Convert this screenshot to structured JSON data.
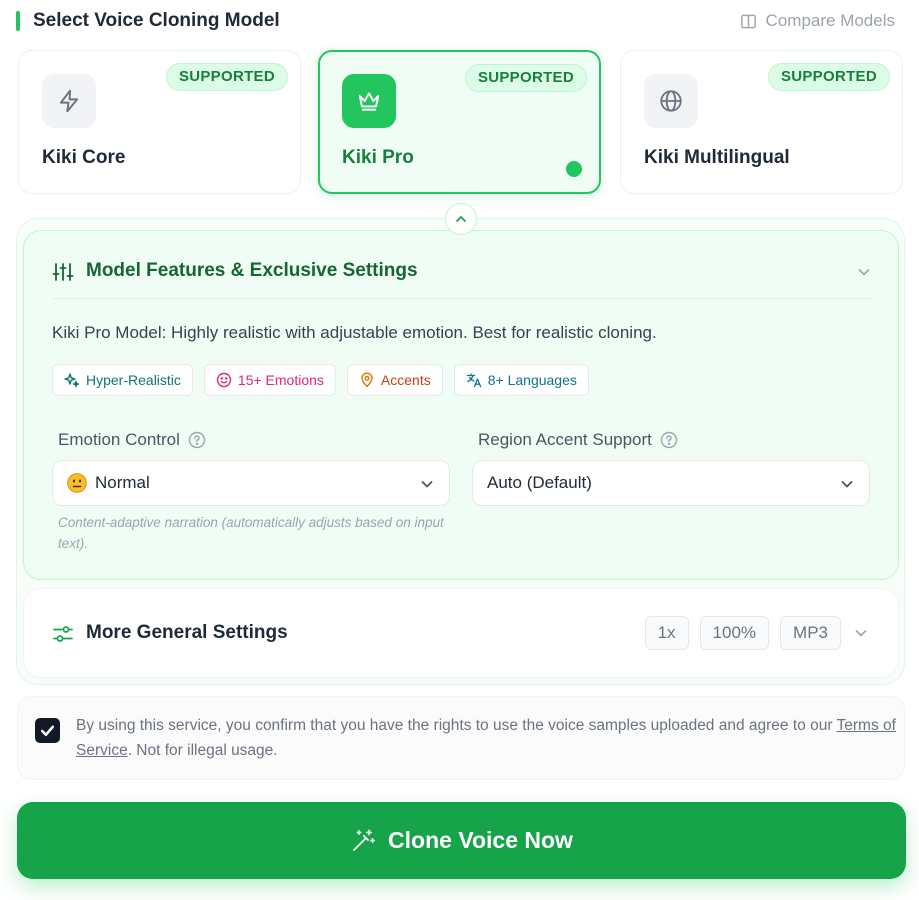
{
  "section": {
    "title": "Select Voice Cloning Model",
    "compare_label": "Compare Models"
  },
  "models": [
    {
      "name": "Kiki Core",
      "badge": "SUPPORTED",
      "icon": "lightning-icon",
      "selected": false
    },
    {
      "name": "Kiki Pro",
      "badge": "SUPPORTED",
      "icon": "crown-icon",
      "selected": true
    },
    {
      "name": "Kiki Multilingual",
      "badge": "SUPPORTED",
      "icon": "globe-icon",
      "selected": false
    }
  ],
  "features": {
    "title": "Model Features & Exclusive Settings",
    "description": "Kiki Pro Model: Highly realistic with adjustable emotion. Best for realistic cloning.",
    "tags": [
      {
        "label": "Hyper-Realistic",
        "icon": "sparkles-icon",
        "color": "#0f766e"
      },
      {
        "label": "15+ Emotions",
        "icon": "smile-icon",
        "color": "#db2777"
      },
      {
        "label": "Accents",
        "icon": "map-pin-icon",
        "color": "#c2410c"
      },
      {
        "label": "8+ Languages",
        "icon": "translate-icon",
        "color": "#0e7490"
      }
    ],
    "emotion": {
      "label": "Emotion Control",
      "value": "Normal",
      "hint": "Content-adaptive narration (automatically adjusts based on input text)."
    },
    "accent": {
      "label": "Region Accent Support",
      "value": "Auto (Default)"
    }
  },
  "general": {
    "title": "More General Settings",
    "pills": [
      "1x",
      "100%",
      "MP3"
    ]
  },
  "consent": {
    "checked": true,
    "text_before": "By using this service, you confirm that you have the rights to use the voice samples uploaded and agree to our ",
    "link": "Terms of Service",
    "text_after": ". Not for illegal usage."
  },
  "cta": {
    "label": "Clone Voice Now"
  },
  "colors": {
    "accent": "#22c55e",
    "accent_dark": "#16a34a",
    "accent_text": "#15803d"
  }
}
